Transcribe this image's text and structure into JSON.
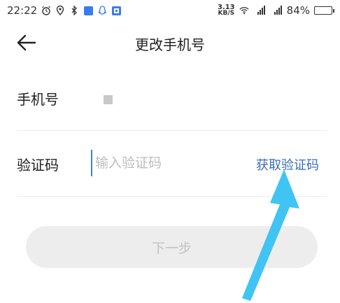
{
  "status_bar": {
    "time": "22:22",
    "net_speed_value": "3.13",
    "net_speed_unit": "KB/S",
    "sim_label_1": "5",
    "sim_label_2": "4G",
    "battery": "84%",
    "battery_level": 0.84
  },
  "header": {
    "title": "更改手机号"
  },
  "form": {
    "phone_label": "手机号",
    "code_label": "验证码",
    "code_placeholder": "输入验证码",
    "code_value": "",
    "get_code_label": "获取验证码"
  },
  "next_button": {
    "label": "下一步"
  },
  "colors": {
    "link": "#3b6db5",
    "arrow": "#3fc4f4",
    "button_bg": "#ededed"
  }
}
